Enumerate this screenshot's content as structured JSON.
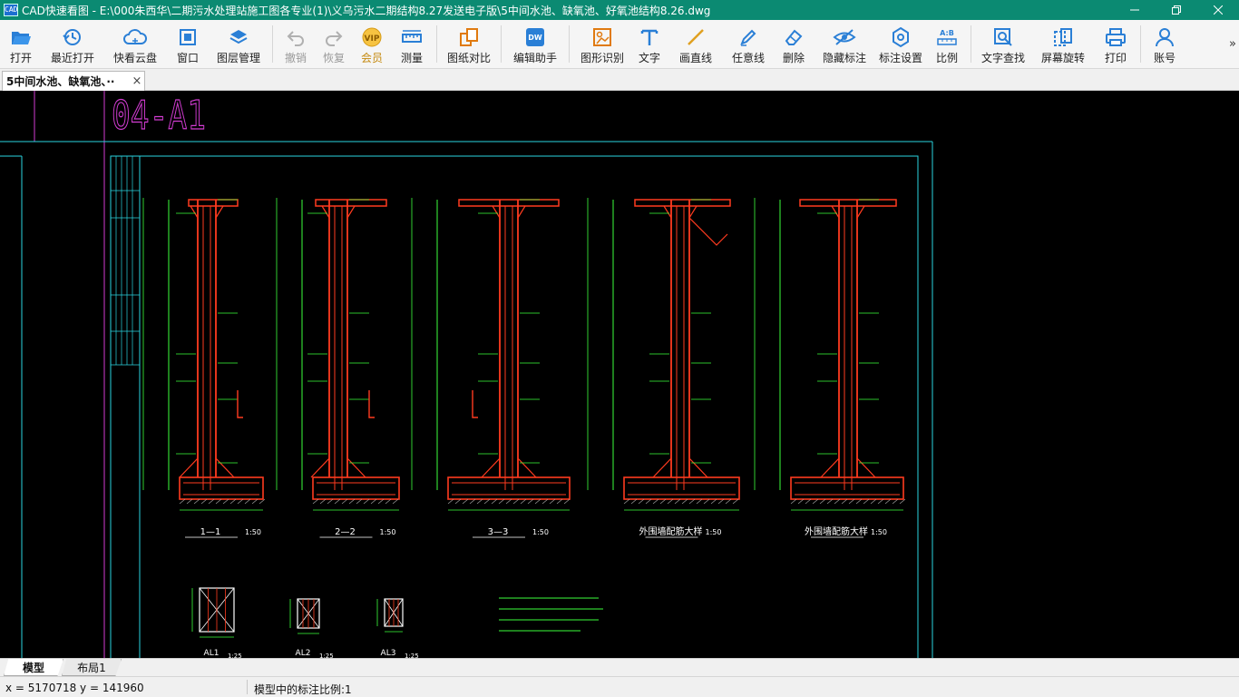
{
  "window": {
    "title": "CAD快速看图 - E:\\000朱西华\\二期污水处理站施工图各专业(1)\\义乌污水二期结构8.27发送电子版\\5中间水池、缺氧池、好氧池结构8.26.dwg",
    "icon_text": "CAD"
  },
  "toolbar": {
    "items": [
      {
        "label": "打开",
        "icon": "folder-open-icon"
      },
      {
        "label": "最近打开",
        "icon": "recent-clock-icon"
      },
      {
        "label": "快看云盘",
        "icon": "cloud-icon"
      },
      {
        "label": "窗口",
        "icon": "window-icon"
      },
      {
        "label": "图层管理",
        "icon": "layers-icon"
      },
      {
        "label": "撤销",
        "icon": "undo-icon",
        "disabled": true
      },
      {
        "label": "恢复",
        "icon": "redo-icon",
        "disabled": true
      },
      {
        "label": "会员",
        "icon": "vip-icon"
      },
      {
        "label": "测量",
        "icon": "ruler-icon"
      },
      {
        "label": "图纸对比",
        "icon": "compare-icon"
      },
      {
        "label": "编辑助手",
        "icon": "edit-assistant-icon"
      },
      {
        "label": "图形识别",
        "icon": "shape-recognize-icon"
      },
      {
        "label": "文字",
        "icon": "text-icon"
      },
      {
        "label": "画直线",
        "icon": "line-icon"
      },
      {
        "label": "任意线",
        "icon": "pen-icon"
      },
      {
        "label": "删除",
        "icon": "eraser-icon"
      },
      {
        "label": "隐藏标注",
        "icon": "eye-hide-icon"
      },
      {
        "label": "标注设置",
        "icon": "annotation-settings-icon"
      },
      {
        "label": "比例",
        "icon": "scale-icon"
      },
      {
        "label": "文字查找",
        "icon": "text-search-icon"
      },
      {
        "label": "屏幕旋转",
        "icon": "rotate-screen-icon"
      },
      {
        "label": "打印",
        "icon": "printer-icon"
      },
      {
        "label": "账号",
        "icon": "user-icon"
      }
    ],
    "more": "»"
  },
  "doc_tab": {
    "label": "5中间水池、缺氧池、··",
    "close": "×"
  },
  "drawing": {
    "sheet_label": "04-A1",
    "sections": [
      {
        "label": "1—1",
        "scale": "1:50"
      },
      {
        "label": "2—2",
        "scale": "1:50"
      },
      {
        "label": "3—3",
        "scale": "1:50"
      },
      {
        "label": "外围墙配筋大样",
        "scale": "1:50"
      },
      {
        "label": "外围墙配筋大样",
        "scale": "1:50"
      }
    ],
    "column_details": [
      {
        "label": "AL1",
        "scale": "1:25"
      },
      {
        "label": "AL2",
        "scale": "1:25"
      },
      {
        "label": "AL3",
        "scale": "1:25"
      }
    ],
    "colors": {
      "wall": "#ff3b1f",
      "dim": "#3cff3c",
      "frame": "#2ad4e0",
      "magenta": "#d23cd2",
      "text": "#ffffff"
    }
  },
  "layout_tabs": [
    {
      "label": "模型"
    },
    {
      "label": "布局1"
    }
  ],
  "status": {
    "coords": "x = 5170718  y = 141960",
    "annotation_scale": "模型中的标注比例:1"
  }
}
